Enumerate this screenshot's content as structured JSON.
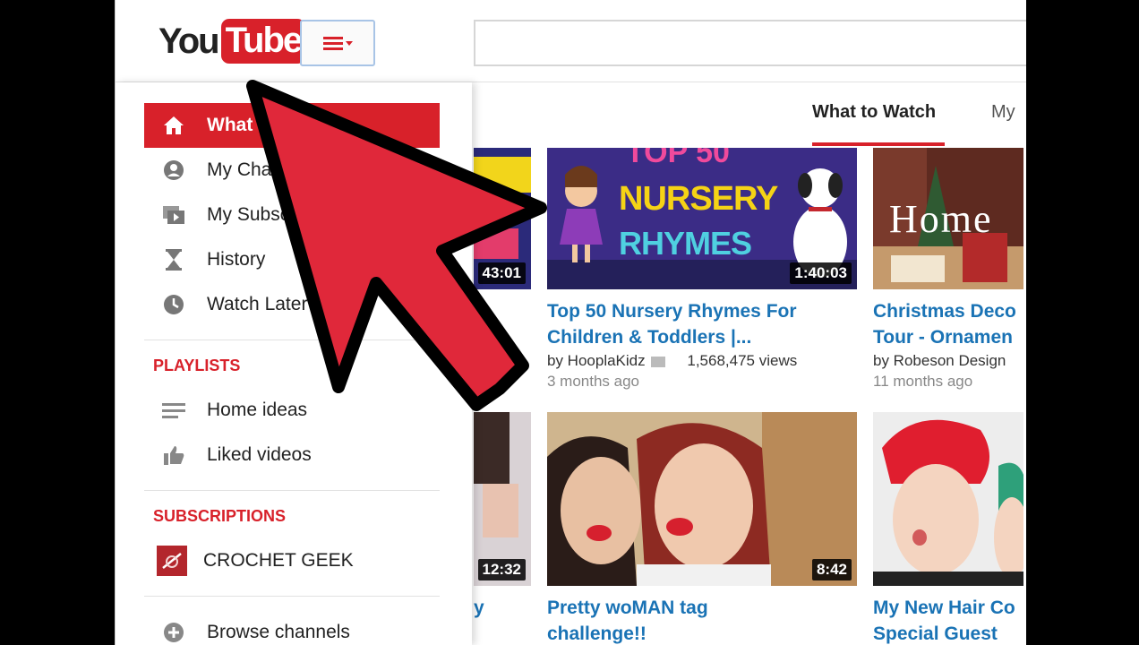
{
  "header": {
    "logo_you": "You",
    "logo_tube": "Tube"
  },
  "guide": {
    "items": [
      {
        "label": "What to Watch",
        "icon": "home-icon"
      },
      {
        "label": "My Channel",
        "icon": "person-icon"
      },
      {
        "label": "My Subscriptions",
        "icon": "subscriptions-icon"
      },
      {
        "label": "History",
        "icon": "hourglass-icon"
      },
      {
        "label": "Watch Later",
        "icon": "clock-icon"
      }
    ],
    "playlists_heading": "PLAYLISTS",
    "playlists": [
      {
        "label": "Home ideas",
        "icon": "playlist-icon"
      },
      {
        "label": "Liked videos",
        "icon": "thumbs-up-icon"
      }
    ],
    "subscriptions_heading": "SUBSCRIPTIONS",
    "subscriptions": [
      {
        "label": "CROCHET GEEK",
        "icon": "channel-thumbnail"
      }
    ],
    "browse": {
      "label": "Browse channels",
      "icon": "add-circle-icon"
    }
  },
  "tabs": [
    {
      "label": "What to Watch"
    },
    {
      "label": "My"
    }
  ],
  "videos": [
    {
      "duration": "43:01",
      "title_lines": [
        "",
        ""
      ],
      "channel": "",
      "views": "",
      "age": ""
    },
    {
      "duration": "1:40:03",
      "title_lines": [
        "Top 50 Nursery Rhymes For",
        "Children & Toddlers |..."
      ],
      "channel": "by HooplaKidz",
      "views": "1,568,475 views",
      "age": "3 months ago",
      "thumb_text_top": "TOP 50",
      "thumb_text_mid": "NURSERY",
      "thumb_text_bot": "RHYMES"
    },
    {
      "duration": "",
      "title_lines": [
        "Christmas Deco",
        "Tour - Ornamen"
      ],
      "channel": "by Robeson Design",
      "views": "",
      "age": "11 months ago",
      "thumb_text": "Home"
    },
    {
      "duration": "12:32",
      "title_lines": [
        "y",
        ""
      ],
      "channel": "",
      "views": "",
      "age": ""
    },
    {
      "duration": "8:42",
      "title_lines": [
        "Pretty woMAN tag",
        "challenge!!"
      ],
      "channel": "",
      "views": "",
      "age": ""
    },
    {
      "duration": "",
      "title_lines": [
        "My New Hair Co",
        "Special Guest"
      ],
      "channel": "",
      "views": "",
      "age": ""
    }
  ],
  "colors": {
    "brand_red": "#d8212a",
    "link_blue": "#1a73b5",
    "arrow_red": "#e0283a"
  }
}
